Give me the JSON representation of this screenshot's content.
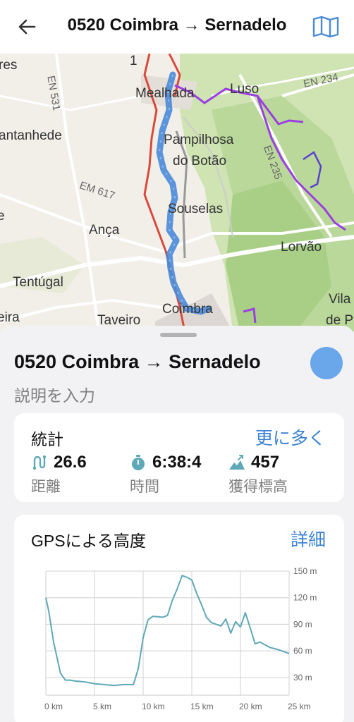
{
  "header": {
    "title": "0520 Coimbra → Sernadelo"
  },
  "map_labels": {
    "res": "res",
    "en531": "EN 531",
    "mealhada": "Mealhada",
    "luso": "Luso",
    "en234": "EN 234",
    "cantanhede": "antanhede",
    "pampilhosa": "Pampilhosa",
    "dobotao": "do Botão",
    "en235": "EN 235",
    "en617": "EM 617",
    "ponte": "e",
    "souselas": "Souselas",
    "anca": "Ança",
    "lorvao": "Lorvão",
    "tentugal": "Tentúgal",
    "vila": "Vila",
    "ira": "eira",
    "taveiro": "Taveiro",
    "coimbra": "Coimbra",
    "dep": "de P",
    "n1": "1"
  },
  "track": {
    "name": "0520 Coimbra → Sernadelo",
    "description_placeholder": "説明を入力",
    "color": "#6aa6ea"
  },
  "stats": {
    "title": "統計",
    "more": "更に多く",
    "items": [
      {
        "icon": "distance-icon",
        "value": "26.6",
        "label": "距離"
      },
      {
        "icon": "stopwatch-icon",
        "value": "6:38:4",
        "label": "時間"
      },
      {
        "icon": "ascent-icon",
        "value": "457",
        "label": "獲得標高"
      }
    ]
  },
  "elevation": {
    "title": "GPSによる高度",
    "detail": "詳細"
  },
  "chart_data": {
    "type": "line",
    "title": "GPSによる高度",
    "x_tick_labels": [
      "0 km",
      "5 km",
      "10 km",
      "15 km",
      "20 km",
      "25 km"
    ],
    "y_tick_labels": [
      "30 m",
      "60 m",
      "90 m",
      "120 m",
      "150 m"
    ],
    "xlim": [
      0,
      25
    ],
    "ylim": [
      10,
      150
    ],
    "color": "#5fa8b8",
    "x": [
      0,
      0.3,
      0.8,
      1.5,
      2,
      2.5,
      3,
      4,
      5,
      6,
      7,
      8,
      9,
      9.5,
      10,
      10.5,
      11,
      12,
      12.5,
      13,
      13.5,
      14,
      14.5,
      15,
      15.5,
      16,
      16.5,
      17,
      18,
      18.5,
      19,
      19.5,
      20,
      20.5,
      21,
      21.5,
      22,
      23,
      24,
      25
    ],
    "y": [
      120,
      105,
      70,
      35,
      27,
      27,
      26,
      25,
      23,
      22,
      21,
      22,
      22,
      40,
      75,
      95,
      99,
      98,
      100,
      117,
      130,
      145,
      143,
      140,
      125,
      112,
      98,
      92,
      88,
      96,
      80,
      93,
      87,
      103,
      86,
      68,
      70,
      64,
      61,
      57
    ]
  }
}
